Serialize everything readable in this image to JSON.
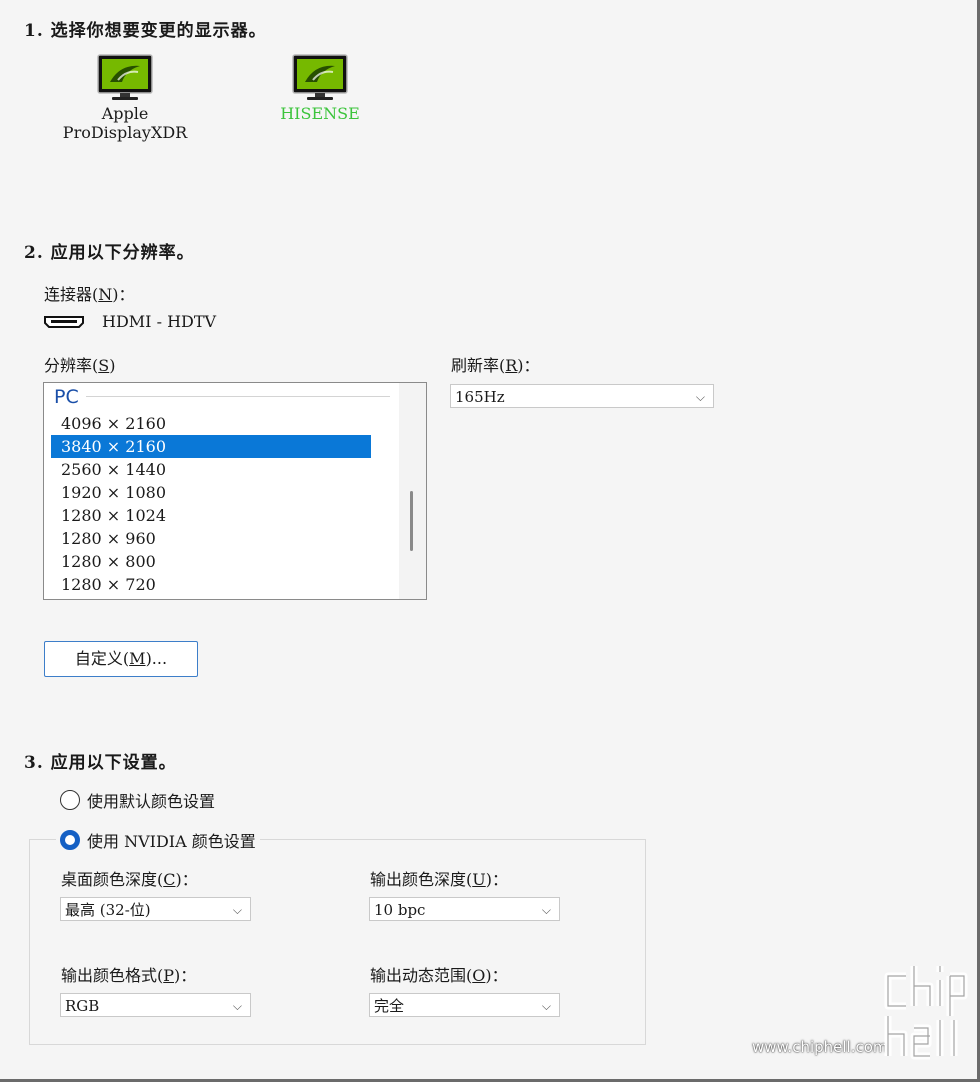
{
  "section1": {
    "title": "1.  选择你想要变更的显示器。",
    "displays": [
      {
        "name": "Apple\nProDisplayXDR",
        "icon": "nvidia-monitor-icon",
        "selected": false
      },
      {
        "name": "HISENSE",
        "icon": "nvidia-monitor-icon",
        "selected": true
      }
    ]
  },
  "section2": {
    "title": "2.  应用以下分辨率。",
    "connector_label": "连接器(",
    "connector_key": "N",
    "connector_label_end": ")：",
    "connector_value": "HDMI - HDTV",
    "connector_icon": "hdmi-connector-icon",
    "resolution_label": "分辨率(",
    "resolution_key": "S",
    "resolution_label_end": ")",
    "resolution_group": "PC",
    "resolutions": [
      "4096 × 2160",
      "3840 × 2160",
      "2560 × 1440",
      "1920 × 1080",
      "1280 × 1024",
      "1280 × 960",
      "1280 × 800",
      "1280 × 720"
    ],
    "selected_resolution": "3840 × 2160",
    "refresh_label": "刷新率(",
    "refresh_key": "R",
    "refresh_label_end": ")：",
    "refresh_value": "165Hz",
    "custom_button_pre": "自定义(",
    "custom_button_key": "M",
    "custom_button_post": ")..."
  },
  "section3": {
    "title": "3.  应用以下设置。",
    "radio_default": "使用默认颜色设置",
    "radio_nvidia": "使用 NVIDIA 颜色设置",
    "selected_radio": "nvidia",
    "desktop_depth_label": "桌面颜色深度(",
    "desktop_depth_key": "C",
    "desktop_depth_label_end": ")：",
    "desktop_depth_value": "最高 (32-位)",
    "output_depth_label": "输出颜色深度(",
    "output_depth_key": "U",
    "output_depth_label_end": ")：",
    "output_depth_value": "10 bpc",
    "output_format_label": "输出颜色格式(",
    "output_format_key": "P",
    "output_format_label_end": ")：",
    "output_format_value": "RGB",
    "output_range_label": "输出动态范围(",
    "output_range_key": "O",
    "output_range_label_end": ")：",
    "output_range_value": "完全"
  },
  "watermark": {
    "url": "www.chiphell.com",
    "logo_text": "chip hell"
  },
  "colors": {
    "selection": "#0a78d7",
    "selected_display_text": "#3cc43c",
    "nvidia_green": "#76b900",
    "radio_accent": "#1560c4"
  }
}
